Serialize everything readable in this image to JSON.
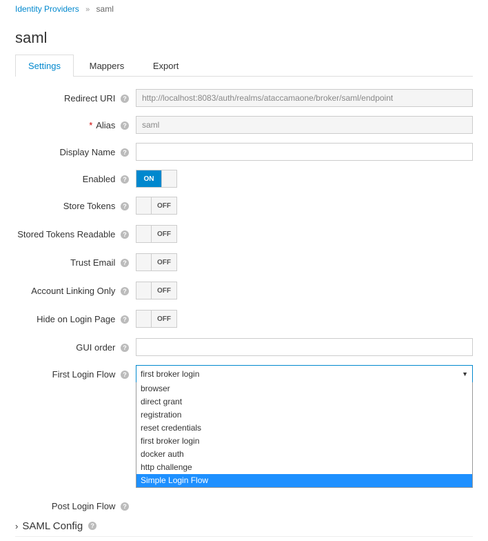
{
  "breadcrumb": {
    "parent": "Identity Providers",
    "current": "saml"
  },
  "title": "saml",
  "tabs": {
    "settings": "Settings",
    "mappers": "Mappers",
    "export": "Export"
  },
  "labels": {
    "redirect_uri": "Redirect URI",
    "alias": "Alias",
    "display_name": "Display Name",
    "enabled": "Enabled",
    "store_tokens": "Store Tokens",
    "stored_tokens_readable": "Stored Tokens Readable",
    "trust_email": "Trust Email",
    "account_linking_only": "Account Linking Only",
    "hide_on_login_page": "Hide on Login Page",
    "gui_order": "GUI order",
    "first_login_flow": "First Login Flow",
    "post_login_flow": "Post Login Flow"
  },
  "values": {
    "redirect_uri": "http://localhost:8083/auth/realms/ataccamaone/broker/saml/endpoint",
    "alias": "saml",
    "display_name": "",
    "gui_order": "",
    "enabled": true,
    "store_tokens": false,
    "stored_tokens_readable": false,
    "trust_email": false,
    "account_linking_only": false,
    "hide_on_login_page": false,
    "first_login_flow": "first broker login"
  },
  "toggle_text": {
    "on": "ON",
    "off": "OFF"
  },
  "flow_options": [
    "browser",
    "direct grant",
    "registration",
    "reset credentials",
    "first broker login",
    "docker auth",
    "http challenge",
    "Simple Login Flow"
  ],
  "flow_highlighted": "Simple Login Flow",
  "section": {
    "saml_config": "SAML Config"
  }
}
